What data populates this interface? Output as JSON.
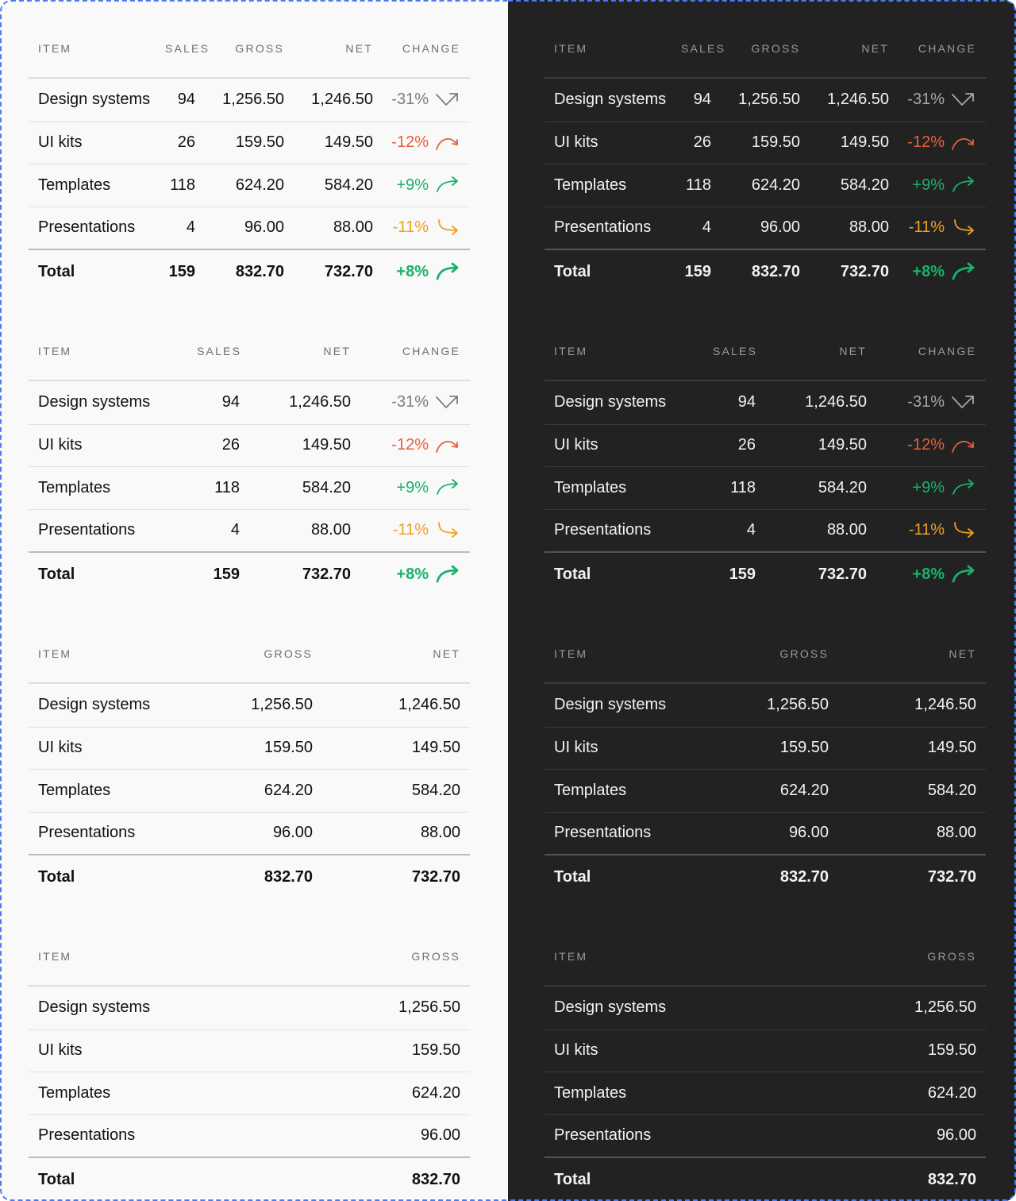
{
  "headers": {
    "item": "ITEM",
    "sales": "SALES",
    "gross": "GROSS",
    "net": "NET",
    "change": "CHANGE"
  },
  "rows": [
    {
      "item": "Design systems",
      "sales": "94",
      "gross": "1,256.50",
      "net": "1,246.50",
      "change": "-31%",
      "trend": "neutral",
      "arrow": "diag-up-right-icon"
    },
    {
      "item": "UI kits",
      "sales": "26",
      "gross": "159.50",
      "net": "149.50",
      "change": "-12%",
      "trend": "red",
      "arrow": "curve-down-icon"
    },
    {
      "item": "Templates",
      "sales": "118",
      "gross": "624.20",
      "net": "584.20",
      "change": "+9%",
      "trend": "green",
      "arrow": "curve-up-right-icon"
    },
    {
      "item": "Presentations",
      "sales": "4",
      "gross": "96.00",
      "net": "88.00",
      "change": "-11%",
      "trend": "orange",
      "arrow": "turn-down-right-icon"
    }
  ],
  "total": {
    "item": "Total",
    "sales": "159",
    "gross": "832.70",
    "net": "732.70",
    "change": "+8%",
    "trend": "green",
    "arrow": "curve-up-right-bold-icon"
  },
  "colors": {
    "light_bg": "#f9f9f9",
    "dark_bg": "#222222",
    "red": "#e5603b",
    "green": "#18b26b",
    "orange": "#f0a020",
    "neutral": "#7d7d7d",
    "frame": "#4b7bf5"
  }
}
